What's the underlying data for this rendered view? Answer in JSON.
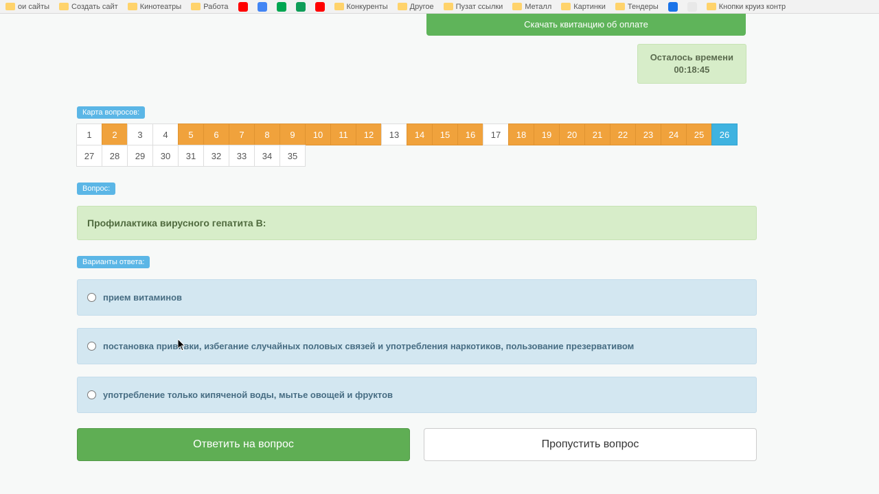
{
  "bookmarks": [
    {
      "label": "ои сайты",
      "type": "folder"
    },
    {
      "label": "Создать сайт",
      "type": "folder"
    },
    {
      "label": "Кинотеатры",
      "type": "folder"
    },
    {
      "label": "Работа",
      "type": "folder"
    },
    {
      "label": "",
      "type": "ico",
      "bg": "#ff0000"
    },
    {
      "label": "",
      "type": "ico",
      "bg": "#4285f4"
    },
    {
      "label": "",
      "type": "ico",
      "bg": "#00a651"
    },
    {
      "label": "",
      "type": "ico",
      "bg": "#0f9d58"
    },
    {
      "label": "",
      "type": "ico",
      "bg": "#ff0000"
    },
    {
      "label": "Конкуренты",
      "type": "folder"
    },
    {
      "label": "Другое",
      "type": "folder"
    },
    {
      "label": "Пузат ссылки",
      "type": "folder"
    },
    {
      "label": "Металл",
      "type": "folder"
    },
    {
      "label": "Картинки",
      "type": "folder"
    },
    {
      "label": "Тендеры",
      "type": "folder"
    },
    {
      "label": "",
      "type": "ico",
      "bg": "#1a73e8"
    },
    {
      "label": "",
      "type": "ico",
      "bg": "#e8e8e8"
    },
    {
      "label": "Кнопки круиз контр",
      "type": "folder"
    }
  ],
  "download_label": "Скачать квитанцию об оплате",
  "timer": {
    "title": "Осталось времени",
    "value": "00:18:45"
  },
  "map_label": "Карта вопросов:",
  "questions": [
    {
      "n": 1,
      "s": "plain"
    },
    {
      "n": 2,
      "s": "orange"
    },
    {
      "n": 3,
      "s": "plain"
    },
    {
      "n": 4,
      "s": "plain"
    },
    {
      "n": 5,
      "s": "orange"
    },
    {
      "n": 6,
      "s": "orange"
    },
    {
      "n": 7,
      "s": "orange"
    },
    {
      "n": 8,
      "s": "orange"
    },
    {
      "n": 9,
      "s": "orange"
    },
    {
      "n": 10,
      "s": "orange"
    },
    {
      "n": 11,
      "s": "orange"
    },
    {
      "n": 12,
      "s": "orange"
    },
    {
      "n": 13,
      "s": "plain"
    },
    {
      "n": 14,
      "s": "orange"
    },
    {
      "n": 15,
      "s": "orange"
    },
    {
      "n": 16,
      "s": "orange"
    },
    {
      "n": 17,
      "s": "plain"
    },
    {
      "n": 18,
      "s": "orange"
    },
    {
      "n": 19,
      "s": "orange"
    },
    {
      "n": 20,
      "s": "orange"
    },
    {
      "n": 21,
      "s": "orange"
    },
    {
      "n": 22,
      "s": "orange"
    },
    {
      "n": 23,
      "s": "orange"
    },
    {
      "n": 24,
      "s": "orange"
    },
    {
      "n": 25,
      "s": "orange"
    },
    {
      "n": 26,
      "s": "blue"
    },
    {
      "n": 27,
      "s": "plain"
    },
    {
      "n": 28,
      "s": "plain"
    },
    {
      "n": 29,
      "s": "plain"
    },
    {
      "n": 30,
      "s": "plain"
    },
    {
      "n": 31,
      "s": "plain"
    },
    {
      "n": 32,
      "s": "plain"
    },
    {
      "n": 33,
      "s": "plain"
    },
    {
      "n": 34,
      "s": "plain"
    },
    {
      "n": 35,
      "s": "plain"
    }
  ],
  "question_label": "Вопрос:",
  "question_text": "Профилактика вирусного гепатита В:",
  "answers_label": "Варианты ответа:",
  "answers": [
    "прием витаминов",
    "постановка прививки, избегание случайных половых связей и употребления наркотиков, пользование презервативом",
    "употребление только кипяченой воды, мытье овощей и фруктов"
  ],
  "buttons": {
    "answer": "Ответить на вопрос",
    "skip": "Пропустить вопрос"
  }
}
